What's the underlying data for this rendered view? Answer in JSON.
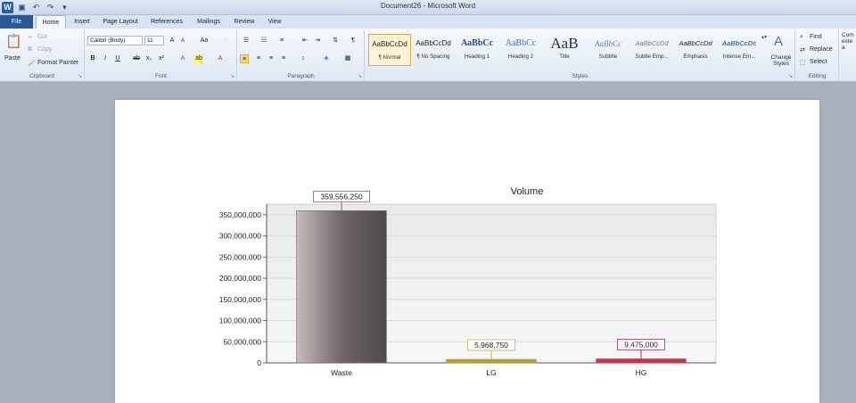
{
  "window": {
    "title": "Document26 - Microsoft Word"
  },
  "tabs": [
    {
      "label": "File"
    },
    {
      "label": "Home"
    },
    {
      "label": "Insert"
    },
    {
      "label": "Page Layout"
    },
    {
      "label": "References"
    },
    {
      "label": "Mailings"
    },
    {
      "label": "Review"
    },
    {
      "label": "View"
    }
  ],
  "clipboard": {
    "group": "Clipboard",
    "paste": "Paste",
    "cut": "Cut",
    "copy": "Copy",
    "format_painter": "Format Painter"
  },
  "font": {
    "group": "Font",
    "name": "Calibri (Body)",
    "size": "11"
  },
  "paragraph": {
    "group": "Paragraph"
  },
  "styles": {
    "group": "Styles",
    "items": [
      {
        "sample": "AaBbCcDd",
        "name": "¶ Normal"
      },
      {
        "sample": "AaBbCcDd",
        "name": "¶ No Spacing"
      },
      {
        "sample": "AaBbCc",
        "name": "Heading 1"
      },
      {
        "sample": "AaBbCc",
        "name": "Heading 2"
      },
      {
        "sample": "AaB",
        "name": "Title"
      },
      {
        "sample": "AaBbCc",
        "name": "Subtitle"
      },
      {
        "sample": "AaBbCcDd",
        "name": "Subtle Emp..."
      },
      {
        "sample": "AaBbCcDd",
        "name": "Emphasis"
      },
      {
        "sample": "AaBbCcDc",
        "name": "Intense Em..."
      }
    ],
    "change_styles": "Change Styles"
  },
  "editing": {
    "group": "Editing",
    "find": "Find",
    "replace": "Replace",
    "select": "Select"
  },
  "extra": {
    "label": "Com este a"
  },
  "colors": {
    "file_tab": "#2b5797",
    "ribbon_accent": "#fbd77e"
  },
  "chart_data": {
    "type": "bar",
    "title": "Volume",
    "categories": [
      "Waste",
      "LG",
      "HG"
    ],
    "values": [
      359556250,
      5968750,
      9475000
    ],
    "data_labels": [
      "359,556,250",
      "5,968,750",
      "9,475,000"
    ],
    "bar_colors": [
      "#6f6668",
      "#b59d35",
      "#c0374f"
    ],
    "label_border_colors": [
      "#6f6668",
      "#c9b040",
      "#b03045"
    ],
    "ylim": [
      0,
      375000000
    ],
    "yticks": [
      0,
      50000000,
      100000000,
      150000000,
      200000000,
      250000000,
      300000000,
      350000000
    ],
    "ytick_labels": [
      "0",
      "50,000,000",
      "100,000,000",
      "150,000,000",
      "200,000,000",
      "250,000,000",
      "300,000,000",
      "350,000,000"
    ],
    "grid": true,
    "xlabel": "",
    "ylabel": ""
  }
}
